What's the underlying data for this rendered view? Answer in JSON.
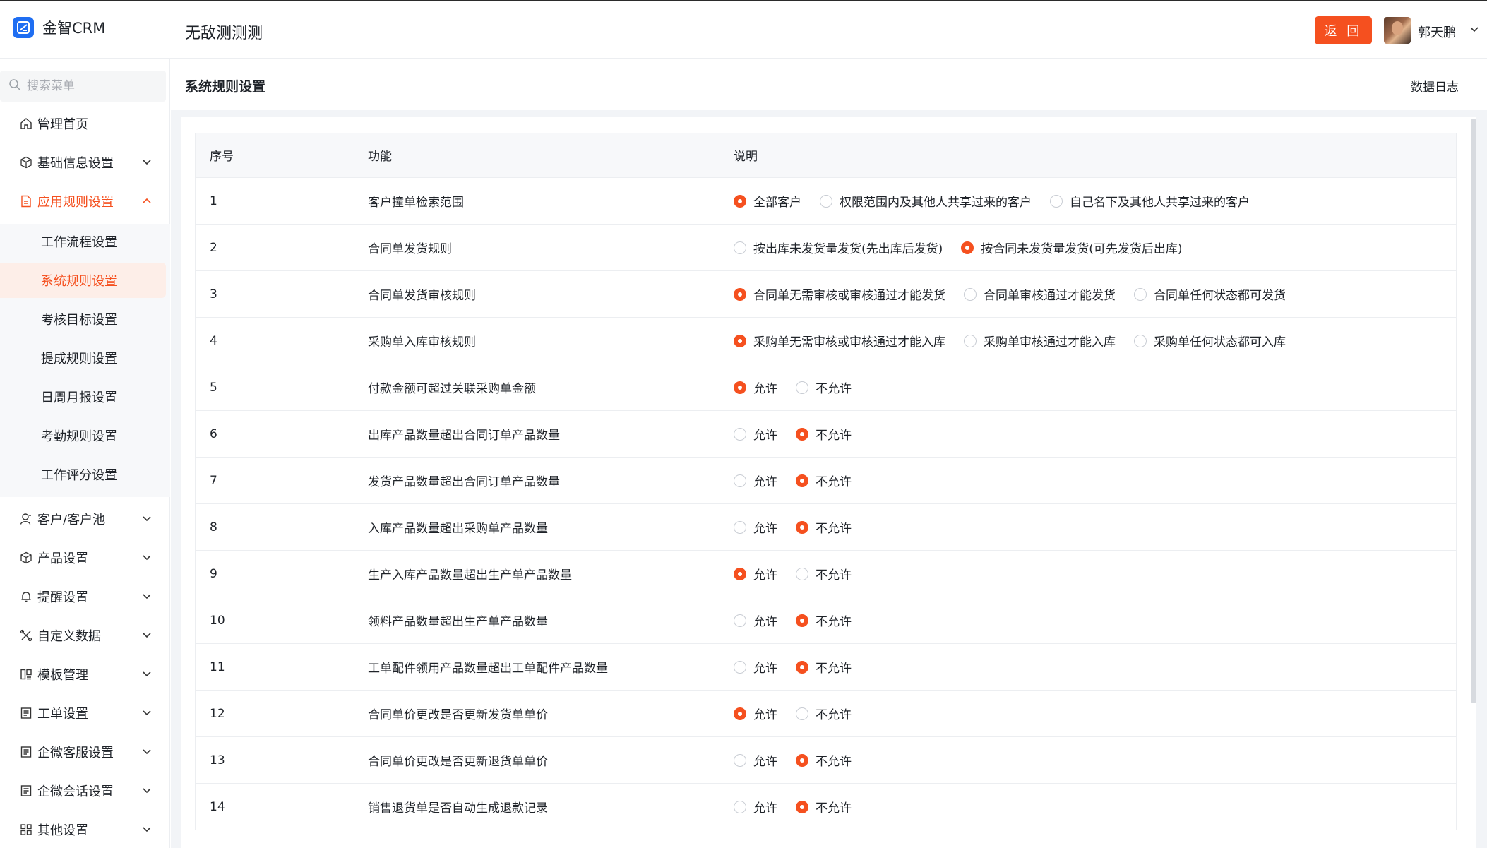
{
  "app": {
    "name": "金智CRM",
    "page_name": "无敌测测测"
  },
  "header": {
    "back_label": "返 回",
    "user_name": "郭天鹏"
  },
  "sidebar": {
    "search_placeholder": "搜索菜单",
    "items": [
      {
        "label": "管理首页",
        "icon": "home-icon",
        "expandable": false
      },
      {
        "label": "基础信息设置",
        "icon": "cube-icon",
        "expandable": true
      },
      {
        "label": "应用规则设置",
        "icon": "document-icon",
        "expandable": true,
        "expanded": true
      },
      {
        "label": "客户/客户池",
        "icon": "user-icon",
        "expandable": true
      },
      {
        "label": "产品设置",
        "icon": "cube-icon",
        "expandable": true
      },
      {
        "label": "提醒设置",
        "icon": "bell-icon",
        "expandable": true
      },
      {
        "label": "自定义数据",
        "icon": "tools-icon",
        "expandable": true
      },
      {
        "label": "模板管理",
        "icon": "template-icon",
        "expandable": true
      },
      {
        "label": "工单设置",
        "icon": "list-icon",
        "expandable": true
      },
      {
        "label": "企微客服设置",
        "icon": "list-icon",
        "expandable": true
      },
      {
        "label": "企微会话设置",
        "icon": "list-icon",
        "expandable": true
      },
      {
        "label": "其他设置",
        "icon": "grid-icon",
        "expandable": true
      }
    ],
    "subitems": [
      {
        "label": "工作流程设置"
      },
      {
        "label": "系统规则设置",
        "active": true
      },
      {
        "label": "考核目标设置"
      },
      {
        "label": "提成规则设置"
      },
      {
        "label": "日周月报设置"
      },
      {
        "label": "考勤规则设置"
      },
      {
        "label": "工作评分设置"
      }
    ]
  },
  "content": {
    "title": "系统规则设置",
    "data_log": "数据日志"
  },
  "table": {
    "headers": [
      "序号",
      "功能",
      "说明"
    ],
    "rows": [
      {
        "no": "1",
        "feature": "客户撞单检索范围",
        "options": [
          "全部客户",
          "权限范围内及其他人共享过来的客户",
          "自己名下及其他人共享过来的客户"
        ],
        "selected": 0
      },
      {
        "no": "2",
        "feature": "合同单发货规则",
        "options": [
          "按出库未发货量发货(先出库后发货)",
          "按合同未发货量发货(可先发货后出库)"
        ],
        "selected": 1
      },
      {
        "no": "3",
        "feature": "合同单发货审核规则",
        "options": [
          "合同单无需审核或审核通过才能发货",
          "合同单审核通过才能发货",
          "合同单任何状态都可发货"
        ],
        "selected": 0
      },
      {
        "no": "4",
        "feature": "采购单入库审核规则",
        "options": [
          "采购单无需审核或审核通过才能入库",
          "采购单审核通过才能入库",
          "采购单任何状态都可入库"
        ],
        "selected": 0
      },
      {
        "no": "5",
        "feature": "付款金额可超过关联采购单金额",
        "options": [
          "允许",
          "不允许"
        ],
        "selected": 0
      },
      {
        "no": "6",
        "feature": "出库产品数量超出合同订单产品数量",
        "options": [
          "允许",
          "不允许"
        ],
        "selected": 1
      },
      {
        "no": "7",
        "feature": "发货产品数量超出合同订单产品数量",
        "options": [
          "允许",
          "不允许"
        ],
        "selected": 1
      },
      {
        "no": "8",
        "feature": "入库产品数量超出采购单产品数量",
        "options": [
          "允许",
          "不允许"
        ],
        "selected": 1
      },
      {
        "no": "9",
        "feature": "生产入库产品数量超出生产单产品数量",
        "options": [
          "允许",
          "不允许"
        ],
        "selected": 0
      },
      {
        "no": "10",
        "feature": "领料产品数量超出生产单产品数量",
        "options": [
          "允许",
          "不允许"
        ],
        "selected": 1
      },
      {
        "no": "11",
        "feature": "工单配件领用产品数量超出工单配件产品数量",
        "options": [
          "允许",
          "不允许"
        ],
        "selected": 1
      },
      {
        "no": "12",
        "feature": "合同单价更改是否更新发货单单价",
        "options": [
          "允许",
          "不允许"
        ],
        "selected": 0
      },
      {
        "no": "13",
        "feature": "合同单价更改是否更新退货单单价",
        "options": [
          "允许",
          "不允许"
        ],
        "selected": 1
      },
      {
        "no": "14",
        "feature": "销售退货单是否自动生成退款记录",
        "options": [
          "允许",
          "不允许"
        ],
        "selected": 1
      }
    ]
  },
  "colors": {
    "accent": "#f5501f",
    "brand": "#1f6ef2",
    "border": "#eceef1",
    "header_bg": "#f7f8fa"
  }
}
